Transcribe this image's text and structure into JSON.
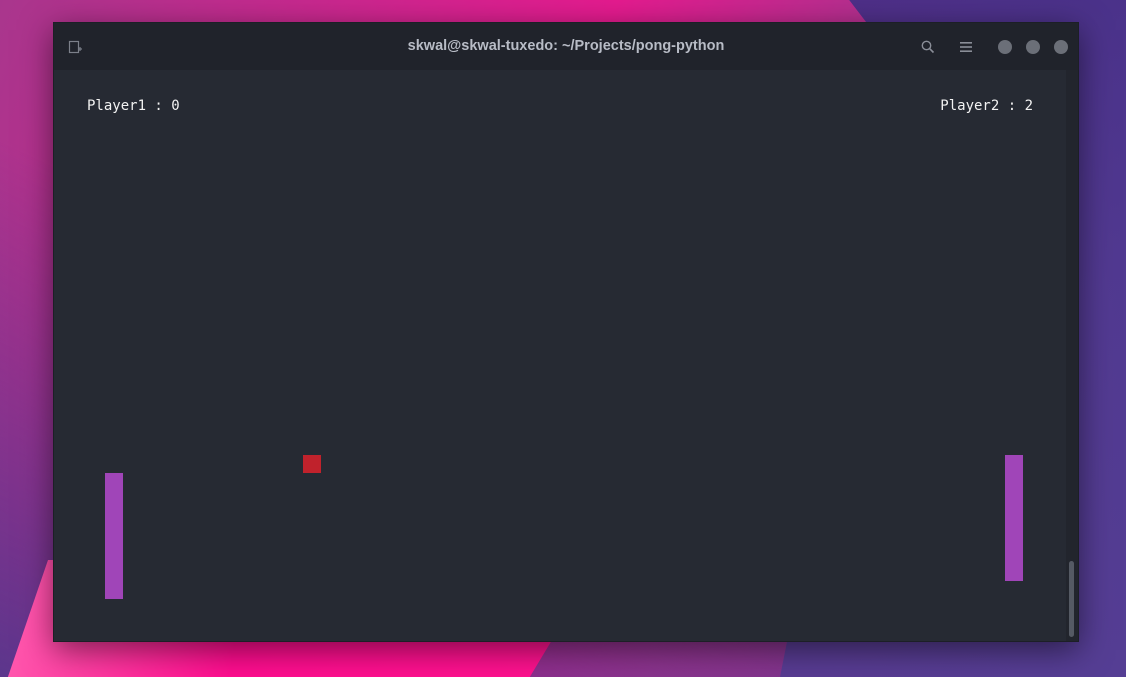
{
  "window": {
    "title": "skwal@skwal-tuxedo: ~/Projects/pong-python",
    "icons": {
      "new_tab": "new-tab-icon",
      "search": "search-icon",
      "menu": "hamburger-menu-icon",
      "minimize": "minimize-icon",
      "maximize": "maximize-icon",
      "close": "close-icon"
    }
  },
  "game": {
    "player1_score_text": "Player1 : 0",
    "player2_score_text": "Player2 : 2",
    "player1_score": 0,
    "player2_score": 2,
    "colors": {
      "background": "#262a33",
      "paddle": "#a045b8",
      "ball": "#c0222c",
      "score_text": "#f2f2f2"
    }
  }
}
